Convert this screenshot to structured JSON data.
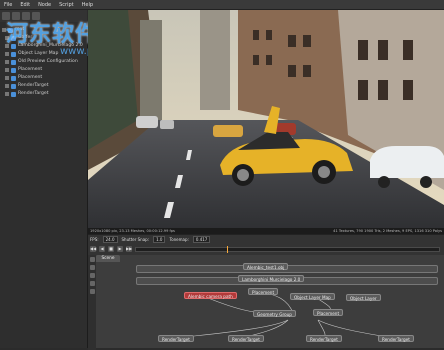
{
  "menu": [
    "File",
    "Edit",
    "Node",
    "Script",
    "Help"
  ],
  "watermark": {
    "main": "河东软件园",
    "url": "www.pc0359.cn"
  },
  "outliner": {
    "items": [
      {
        "label": "root"
      },
      {
        "label": "Gaffer"
      },
      {
        "label": "Lamborghini_Murcielago 2.0"
      },
      {
        "label": "Object Layer Map"
      },
      {
        "label": "Old Preview Configuration"
      },
      {
        "label": "Placement"
      },
      {
        "label": "Placement"
      },
      {
        "label": "RenderTarget"
      },
      {
        "label": "RenderTarget"
      }
    ]
  },
  "viewport": {
    "status_left": "1920x1080 pix, 23.13 Meshes, 00:00:12.99 fps",
    "status_right": "41 Textures, 790 1900 Tris, 2 Meshes, 9 EPS, 1316 310 Polys"
  },
  "timeline": {
    "fps_label": "FPS:",
    "fps_value": "24.0",
    "shutter_label": "Shutter Snap:",
    "shutter_value": "1.0",
    "tonemap_label": "Tonemap:",
    "tonemap_value": "0.417",
    "buttons": [
      "◀◀",
      "◀",
      "■",
      "▶",
      "▶▶"
    ]
  },
  "node_editor": {
    "tab": "Scene",
    "nodes": [
      {
        "label": "Alembic_test1.obj",
        "color": "gray"
      },
      {
        "label": "Lamborghini Murcielago 2.0",
        "color": "gray"
      },
      {
        "label": "Alembic camera path",
        "color": "red"
      },
      {
        "label": "Placement",
        "color": "gray"
      },
      {
        "label": "Object Layer Map",
        "color": "gray"
      },
      {
        "label": "Object Layer",
        "color": "gray"
      },
      {
        "label": "Geometry Group",
        "color": "gray"
      },
      {
        "label": "Placement",
        "color": "gray"
      },
      {
        "label": "RenderTarget",
        "color": "gray"
      },
      {
        "label": "RenderTarget",
        "color": "gray"
      },
      {
        "label": "RenderTarget",
        "color": "gray"
      },
      {
        "label": "RenderTarget",
        "color": "gray"
      }
    ]
  }
}
